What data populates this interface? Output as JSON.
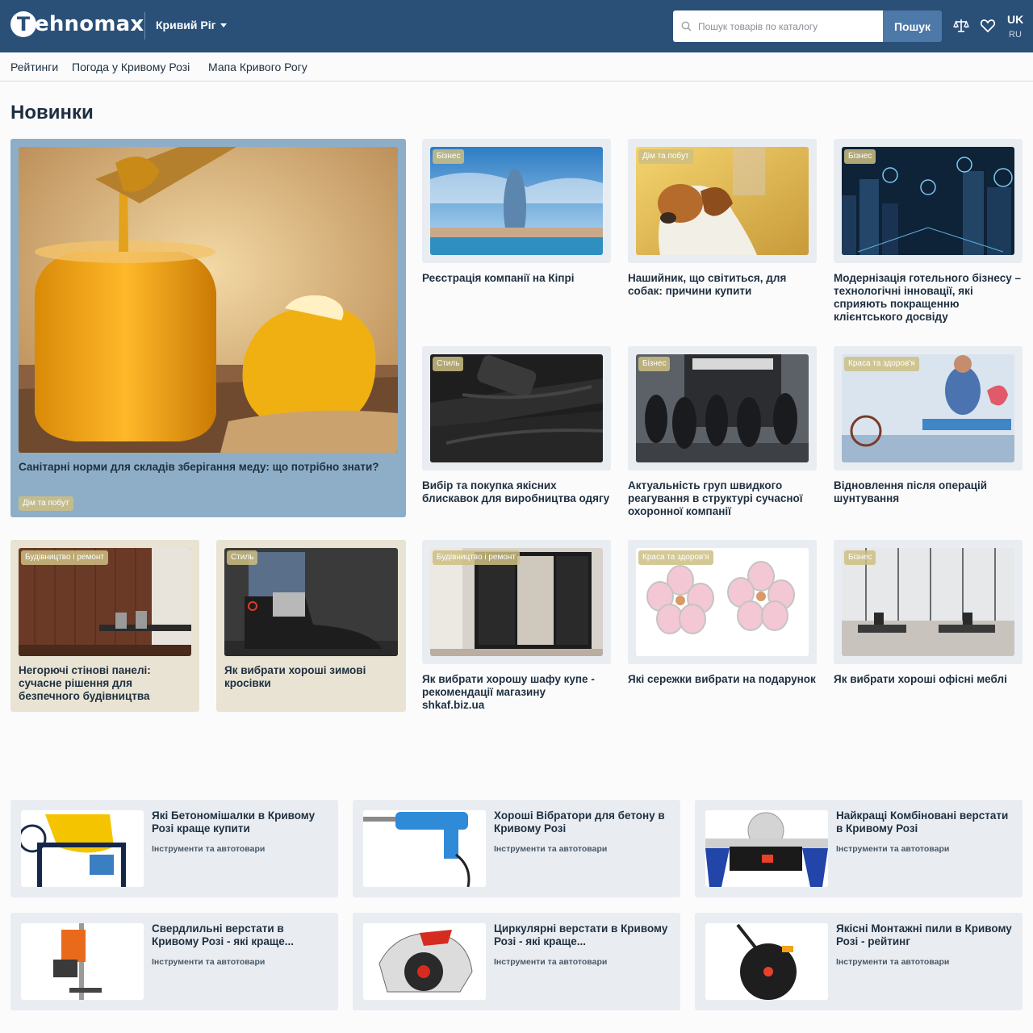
{
  "header": {
    "logo_letter": "T",
    "logo_text": "ehnomax",
    "city": "Кривий Ріг",
    "search_placeholder": "Пошук товарів по каталогу",
    "search_button": "Пошук",
    "lang_active": "UK",
    "lang_other": "RU",
    "icons": [
      "scales-icon",
      "heart-icon"
    ]
  },
  "subnav": [
    "Рейтинги",
    "Погода у Кривому Розі",
    "Мапа Кривого Рогу"
  ],
  "section_title": "Новинки",
  "feature": {
    "title": "Санітарні норми для складів зберігання меду: що потрібно знати?",
    "tag": "Дім та побут"
  },
  "articles": [
    {
      "tag": "Бізнес",
      "title": "Реєстрація компанії на Кіпрі"
    },
    {
      "tag": "Дім та побут",
      "title": "Нашийник, що світиться, для собак: причини купити"
    },
    {
      "tag": "Бізнес",
      "title": "Модернізація готельного бізнесу – технологічні інновації, які сприяють покращенню клієнтського досвіду"
    },
    {
      "tag": "Стиль",
      "title": "Вибір та покупка якісних блискавок для виробництва одягу"
    },
    {
      "tag": "Бізнес",
      "title": "Актуальність груп швидкого реагування в структурі сучасної охоронної компанії"
    },
    {
      "tag": "Краса та здоров'я",
      "title": "Відновлення після операцій шунтування"
    },
    {
      "tag": "Будівництво і ремонт",
      "title": "Негорючі стінові панелі: сучасне рішення для безпечного будівництва"
    },
    {
      "tag": "Стиль",
      "title": "Як вибрати хороші зимові кросівки"
    },
    {
      "tag": "Будівництво і ремонт",
      "title": "Як вибрати хорошу шафу купе - рекомендації магазину shkaf.biz.ua"
    },
    {
      "tag": "Краса та здоров'я",
      "title": "Які сережки вибрати на подарунок"
    },
    {
      "tag": "Бізнес",
      "title": "Як вибрати хороші офісні меблі"
    }
  ],
  "products": [
    {
      "title": "Які Бетономішалки в Кривому Розі краще купити",
      "category": "Інструменти та автотовари"
    },
    {
      "title": "Хороші Вібратори для бетону в Кривому Розі",
      "category": "Інструменти та автотовари"
    },
    {
      "title": "Найкращі Комбіновані верстати в Кривому Розі",
      "category": "Інструменти та автотовари"
    },
    {
      "title": "Свердлильні верстати в Кривому Розі - які краще...",
      "category": "Інструменти та автотовари"
    },
    {
      "title": "Циркулярні верстати в Кривому Розі - які краще...",
      "category": "Інструменти та автотовари"
    },
    {
      "title": "Якісні Монтажні пили в Кривому Розі - рейтинг",
      "category": "Інструменти та автотовари"
    }
  ],
  "colors": {
    "header": "#2a5078",
    "search_button": "#4d79a8",
    "feature_card": "#8eadc6",
    "beige_card": "#e8e3d3",
    "card": "#e9edf2"
  }
}
